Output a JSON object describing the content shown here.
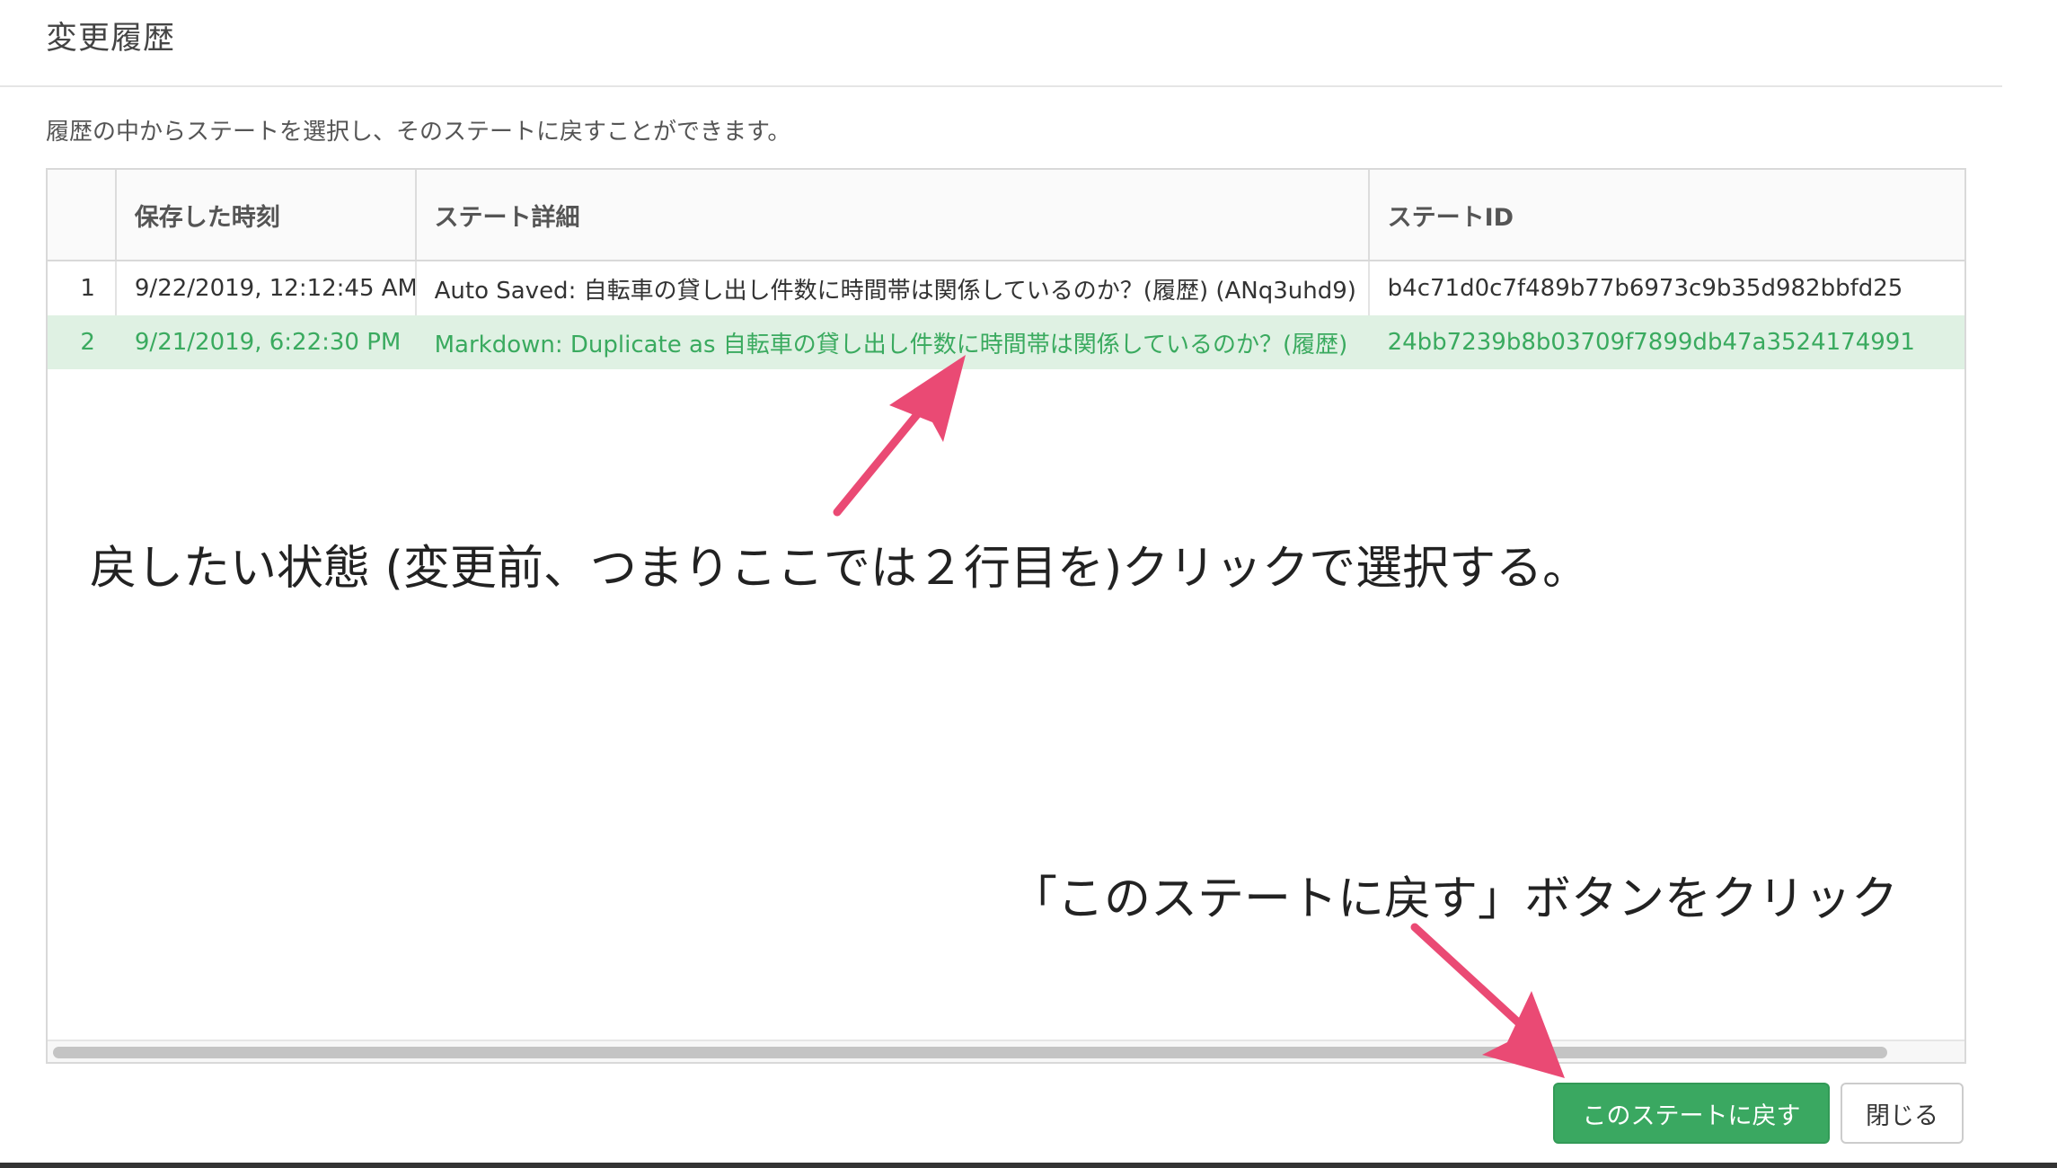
{
  "modal": {
    "title": "変更履歴",
    "description": "履歴の中からステートを選択し、そのステートに戻すことができます。"
  },
  "table": {
    "columns": [
      "",
      "保存した時刻",
      "ステート詳細",
      "ステートID"
    ],
    "rows": [
      {
        "num": "1",
        "time": "9/22/2019, 12:12:45 AM",
        "detail": "Auto Saved: 自転車の貸し出し件数に時間帯は関係しているのか？(履歴) (ANq3uhd9)",
        "id": "b4c71d0c7f489b77b6973c9b35d982bbfd25"
      },
      {
        "num": "2",
        "time": "9/21/2019, 6:22:30 PM",
        "detail": "Markdown: Duplicate as 自転車の貸し出し件数に時間帯は関係しているのか？(履歴)",
        "id": "24bb7239b8b03709f7899db47a3524174991"
      }
    ],
    "selected_row_index": 1
  },
  "annotations": {
    "select_row": "戻したい状態 (変更前、つまりここでは２行目を)クリックで選択する。",
    "click_revert": "「このステートに戻す」ボタンをクリック"
  },
  "buttons": {
    "revert": "このステートに戻す",
    "close": "閉じる"
  },
  "colors": {
    "primary_button": "#3aa861",
    "selected_row_bg": "#dff1e3",
    "selected_row_text": "#3aaa5f",
    "annotation_arrow": "#ea4a74"
  }
}
